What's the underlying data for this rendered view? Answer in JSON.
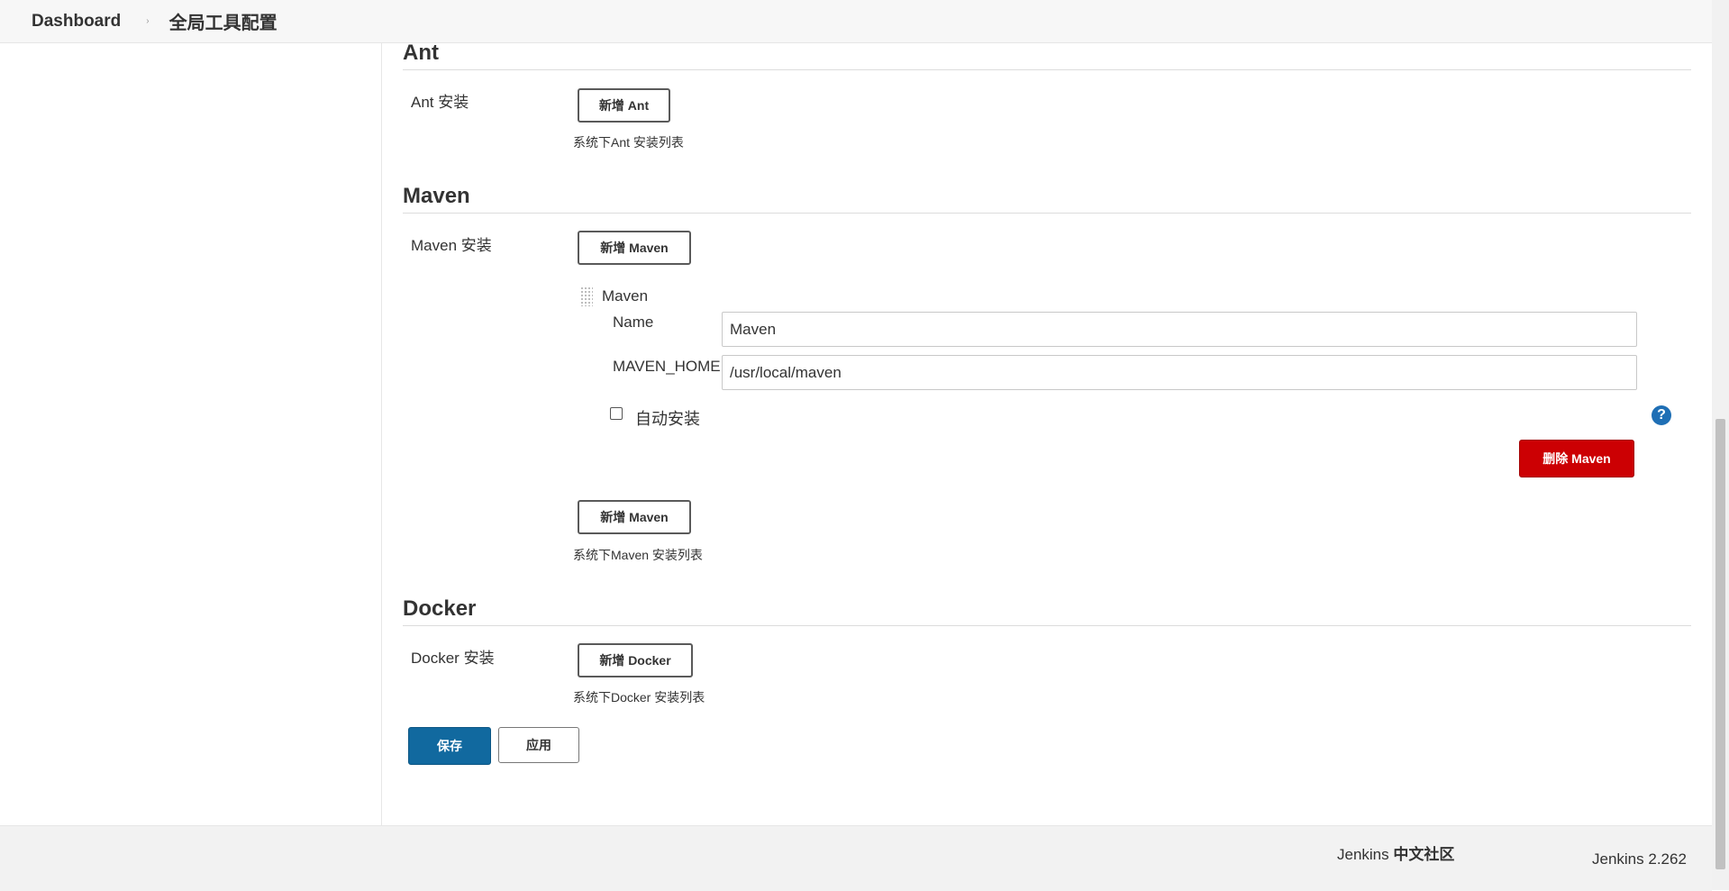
{
  "breadcrumb": {
    "home": "Dashboard",
    "separator": "›",
    "current": "全局工具配置"
  },
  "ant": {
    "title": "Ant",
    "label": "Ant 安装",
    "add_button": "新增 Ant",
    "hint": "系统下Ant 安装列表"
  },
  "maven": {
    "title": "Maven",
    "label": "Maven 安装",
    "add_button_top": "新增 Maven",
    "installation": {
      "title": "Maven",
      "name_label": "Name",
      "name_value": "Maven",
      "home_label": "MAVEN_HOME",
      "home_value": "/usr/local/maven",
      "auto_install_label": "自动安装",
      "auto_install_checked": false,
      "help_glyph": "?",
      "delete_button": "删除 Maven"
    },
    "add_button_bottom": "新增 Maven",
    "hint": "系统下Maven 安装列表"
  },
  "docker": {
    "title": "Docker",
    "label": "Docker 安装",
    "add_button": "新增 Docker",
    "hint": "系统下Docker 安装列表"
  },
  "actions": {
    "save": "保存",
    "apply": "应用"
  },
  "footer": {
    "community_prefix": "Jenkins",
    "community_name": "中文社区",
    "version": "Jenkins 2.262"
  },
  "colors": {
    "primary": "#11699f",
    "danger": "#cc0003",
    "help": "#1f6fb5"
  }
}
